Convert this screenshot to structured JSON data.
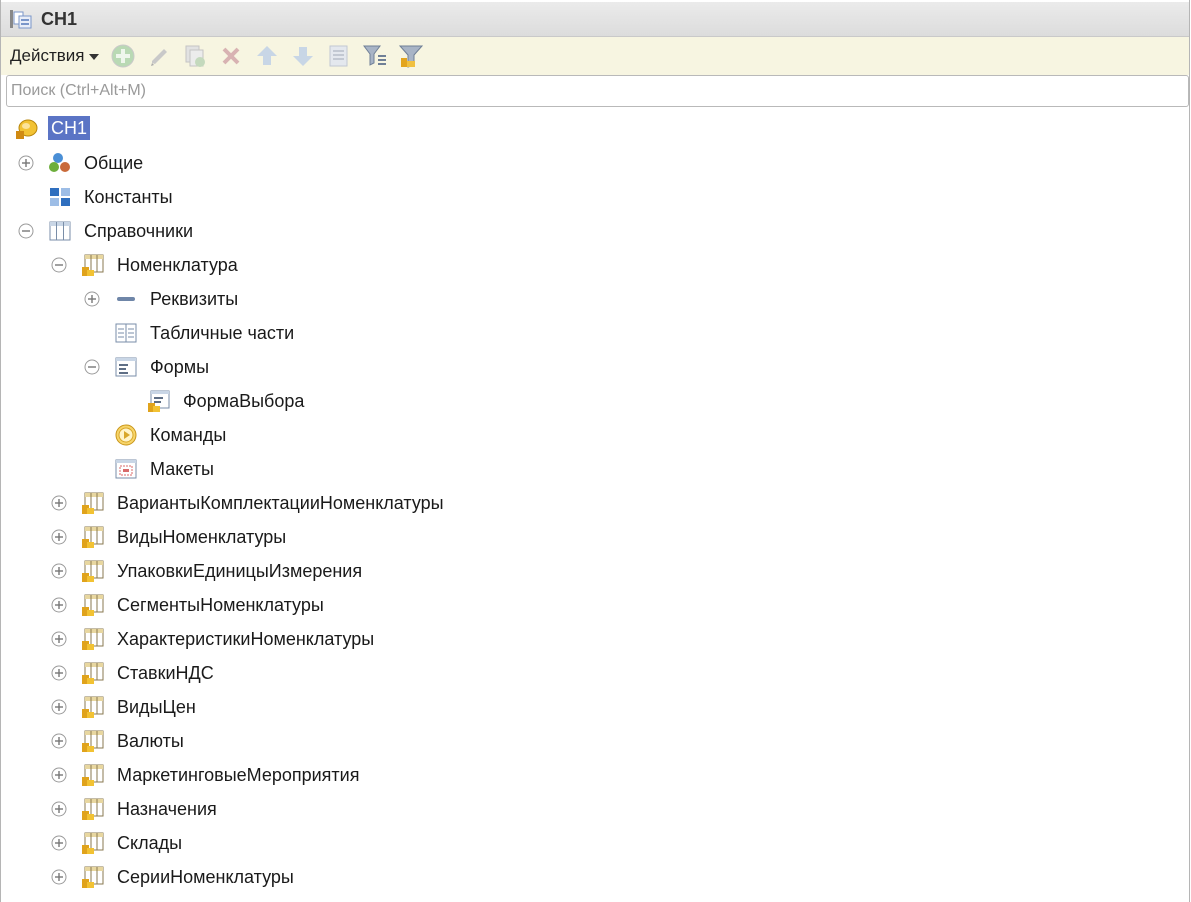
{
  "window": {
    "title": "СН1"
  },
  "toolbar": {
    "actions_label": "Действия",
    "buttons": [
      {
        "icon": "add-icon"
      },
      {
        "icon": "edit-icon"
      },
      {
        "icon": "copy-icon"
      },
      {
        "icon": "delete-icon"
      },
      {
        "icon": "move-up-icon"
      },
      {
        "icon": "move-down-icon"
      },
      {
        "icon": "list-icon"
      },
      {
        "icon": "filter-icon"
      },
      {
        "icon": "filter-settings-icon"
      }
    ]
  },
  "search": {
    "placeholder": "Поиск (Ctrl+Alt+M)",
    "value": ""
  },
  "tree": {
    "root": {
      "label": "СН1",
      "selected": true
    },
    "common": {
      "label": "Общие",
      "expanded": false
    },
    "constants": {
      "label": "Константы"
    },
    "catalogs": {
      "label": "Справочники",
      "expanded": true
    },
    "nomenclature": {
      "label": "Номенклатура",
      "expanded": true,
      "attributes": {
        "label": "Реквизиты",
        "expanded": false
      },
      "tabular_parts": {
        "label": "Табличные части"
      },
      "forms": {
        "label": "Формы",
        "expanded": true,
        "items": [
          "ФормаВыбора"
        ]
      },
      "commands": {
        "label": "Команды"
      },
      "templates": {
        "label": "Макеты"
      }
    },
    "other_catalogs": [
      "ВариантыКомплектацииНоменклатуры",
      "ВидыНоменклатуры",
      "УпаковкиЕдиницыИзмерения",
      "СегментыНоменклатуры",
      "ХарактеристикиНоменклатуры",
      "СтавкиНДС",
      "ВидыЦен",
      "Валюты",
      "МаркетинговыеМероприятия",
      "Назначения",
      "Склады",
      "СерииНоменклатуры"
    ]
  },
  "colors": {
    "toolbar_bg": "#f7f5e1",
    "selection": "#5b74c5",
    "catalog_icon": "#e0a31c"
  }
}
